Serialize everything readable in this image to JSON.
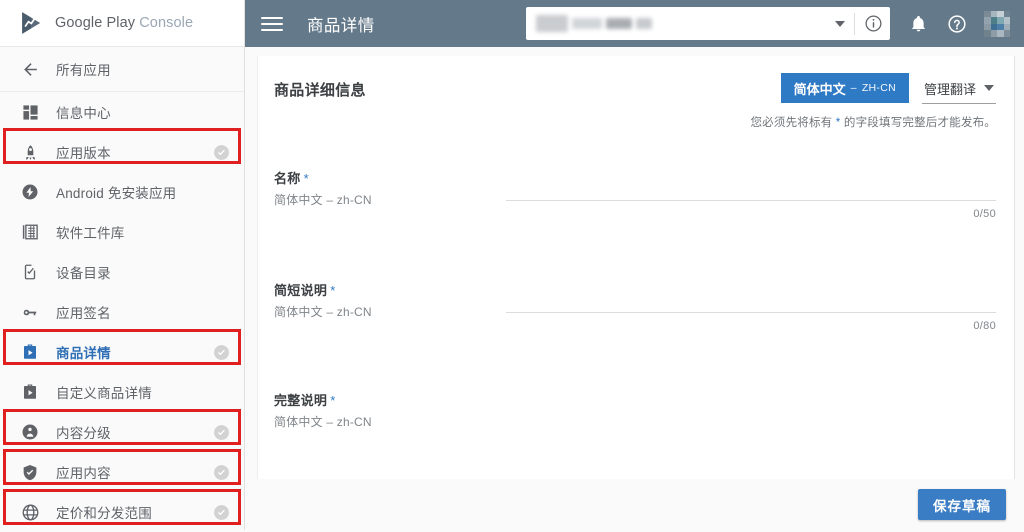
{
  "brand": {
    "word1": "Google Play",
    "word2": "Console",
    "logo_icon": "play-console-logo-icon"
  },
  "sidebar": {
    "back_item": {
      "label": "所有应用",
      "icon": "arrow-left-icon"
    },
    "items": [
      {
        "label": "信息中心",
        "icon": "dashboard-icon",
        "check": false,
        "active": false,
        "highlighted": false
      },
      {
        "label": "应用版本",
        "icon": "rocket-icon",
        "check": true,
        "active": false,
        "highlighted": true
      },
      {
        "label": "Android 免安装应用",
        "icon": "instant-apps-icon",
        "check": false,
        "active": false,
        "highlighted": false
      },
      {
        "label": "软件工件库",
        "icon": "artifact-library-icon",
        "check": false,
        "active": false,
        "highlighted": false
      },
      {
        "label": "设备目录",
        "icon": "device-catalog-icon",
        "check": false,
        "active": false,
        "highlighted": false
      },
      {
        "label": "应用签名",
        "icon": "key-icon",
        "check": false,
        "active": false,
        "highlighted": false
      },
      {
        "label": "商品详情",
        "icon": "store-listing-icon",
        "check": true,
        "active": true,
        "highlighted": true
      },
      {
        "label": "自定义商品详情",
        "icon": "custom-store-listing-icon",
        "check": false,
        "active": false,
        "highlighted": false
      },
      {
        "label": "内容分级",
        "icon": "content-rating-icon",
        "check": true,
        "active": false,
        "highlighted": true
      },
      {
        "label": "应用内容",
        "icon": "app-content-shield-icon",
        "check": true,
        "active": false,
        "highlighted": true
      },
      {
        "label": "定价和分发范围",
        "icon": "globe-icon",
        "check": true,
        "active": false,
        "highlighted": true
      }
    ]
  },
  "topbar": {
    "menu_icon": "hamburger-menu-icon",
    "title": "商品详情",
    "app_selector": {
      "value": "",
      "dropdown_icon": "chevron-down-icon",
      "info_icon": "info-circle-icon"
    },
    "notifications_icon": "bell-icon",
    "help_icon": "help-circle-icon",
    "avatar_icon": "user-avatar"
  },
  "main": {
    "card_title": "商品详细信息",
    "language_chip": {
      "name": "简体中文",
      "dash": "–",
      "code": "ZH-CN"
    },
    "manage_translations": {
      "label": "管理翻译",
      "icon": "chevron-down-icon"
    },
    "required_note_prefix": "您必须先将标有",
    "required_note_star": "*",
    "required_note_suffix": "的字段填写完整后才能发布。",
    "fields": [
      {
        "label": "名称",
        "required_mark": "*",
        "lang": "简体中文 – zh-CN",
        "value": "",
        "counter": "0/50"
      },
      {
        "label": "简短说明",
        "required_mark": "*",
        "lang": "简体中文 – zh-CN",
        "value": "",
        "counter": "0/80"
      },
      {
        "label": "完整说明",
        "required_mark": "*",
        "lang": "简体中文 – zh-CN",
        "value": "",
        "counter": ""
      }
    ]
  },
  "footer": {
    "save_label": "保存草稿"
  },
  "colors": {
    "topbar_bg": "#64798a",
    "accent_blue": "#2f7ac4",
    "active_item": "#2f6fb5",
    "annotation_red": "#e02020",
    "save_button": "#3b7dc4"
  }
}
